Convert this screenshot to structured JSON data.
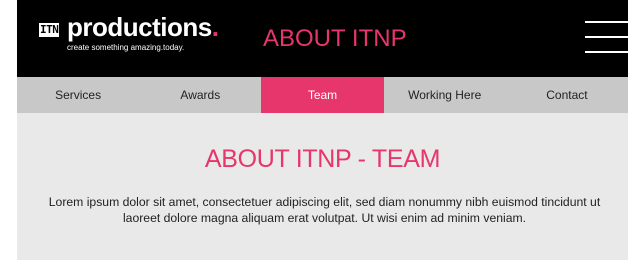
{
  "header": {
    "logo": {
      "mark": "ITN",
      "word": "productions",
      "tagline": "create something amazing.today."
    },
    "title": "ABOUT ITNP",
    "menu_icon": "hamburger-menu-icon"
  },
  "nav": {
    "items": [
      {
        "label": "Services"
      },
      {
        "label": "Awards"
      },
      {
        "label": "Team",
        "active": true
      },
      {
        "label": "Working Here"
      },
      {
        "label": "Contact"
      }
    ]
  },
  "main": {
    "title": "ABOUT ITNP - TEAM",
    "body": "Lorem ipsum dolor sit amet, consectetuer adipiscing elit, sed diam nonummy nibh euismod tincidunt ut laoreet dolore magna aliquam erat volutpat. Ut wisi enim ad minim veniam."
  },
  "colors": {
    "accent": "#e6366c",
    "header_bg": "#000000",
    "nav_bg": "#c8c8c8",
    "content_bg": "#e8e9e8"
  }
}
